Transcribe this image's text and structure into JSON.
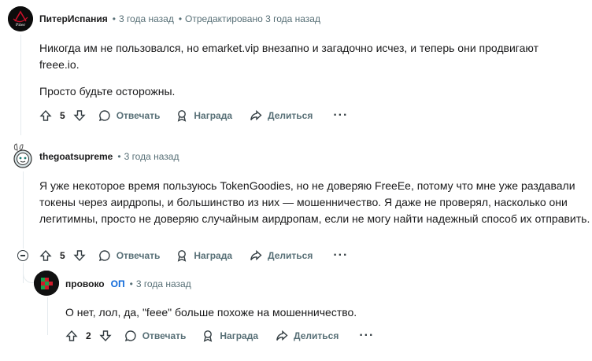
{
  "comments": [
    {
      "author": "ПитерИспания",
      "avatar_caption": "Piter",
      "time": "3 года назад",
      "edited": "Отредактировано 3 года назад",
      "text": [
        "Никогда им не пользовался, но emarket.vip внезапно и загадочно исчез, и теперь они продвигают freee.io.",
        "Просто будьте осторожны."
      ],
      "score": "5",
      "reply_label": "Отвечать",
      "award_label": "Награда",
      "share_label": "Делиться",
      "more_label": "···"
    },
    {
      "author": "thegoatsupreme",
      "time": "3 года назад",
      "text": [
        "Я уже некоторое время пользуюсь TokenGoodies, но не доверяю FreeEe, потому что мне уже раздавали токены через аирдропы, и большинство из них — мошенничество. Я даже не проверял, насколько они легитимны, просто не доверяю случайным аирдропам, если не могу найти надежный способ их отправить."
      ],
      "score": "5",
      "reply_label": "Отвечать",
      "award_label": "Награда",
      "share_label": "Делиться",
      "more_label": "···"
    },
    {
      "author": "провоко",
      "op_badge": "ОП",
      "time": "3 года назад",
      "text": [
        "О нет, лол, да, \"feee\" больше похоже на мошенничество."
      ],
      "score": "2",
      "reply_label": "Отвечать",
      "award_label": "Награда",
      "share_label": "Делиться",
      "more_label": "···"
    }
  ],
  "separator": "•",
  "icons": {
    "upvote": "arrow-up-icon",
    "downvote": "arrow-down-icon",
    "reply": "speech-bubble-icon",
    "award": "award-ribbon-icon",
    "share": "share-arrow-icon",
    "collapse": "minus-circle-icon"
  },
  "colors": {
    "text": "#1a1a1b",
    "meta": "#576f76",
    "op_badge": "#0a66d8",
    "thread_line": "#e5ebee"
  }
}
